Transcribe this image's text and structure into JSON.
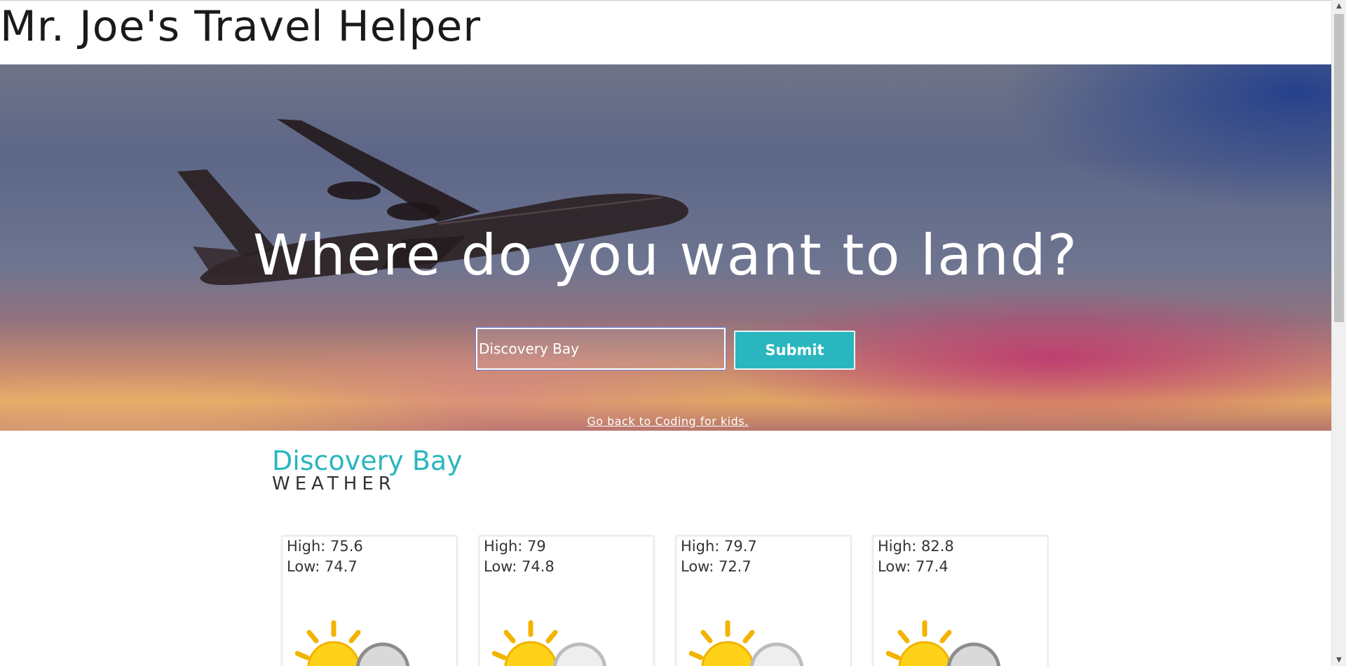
{
  "site": {
    "title": "Mr. Joe's Travel Helper"
  },
  "hero": {
    "heading": "Where do you want to land?",
    "search_value": "Discovery Bay",
    "submit_label": "Submit",
    "back_link": "Go back to Coding for kids."
  },
  "weather": {
    "city": "Discovery Bay",
    "label": "WEATHER",
    "forecast": [
      {
        "high": "High: 75.6",
        "low": "Low: 74.7",
        "icon": "partly-cloudy-icon"
      },
      {
        "high": "High: 79",
        "low": "Low: 74.8",
        "icon": "partly-cloudy-icon"
      },
      {
        "high": "High: 79.7",
        "low": "Low: 72.7",
        "icon": "partly-cloudy-icon"
      },
      {
        "high": "High: 82.8",
        "low": "Low: 77.4",
        "icon": "partly-cloudy-icon"
      }
    ]
  },
  "colors": {
    "accent": "#2ab6bf",
    "text": "#333333"
  },
  "scrollbar": {
    "up_icon": "scroll-up-arrow-icon",
    "down_icon": "scroll-down-arrow-icon"
  }
}
